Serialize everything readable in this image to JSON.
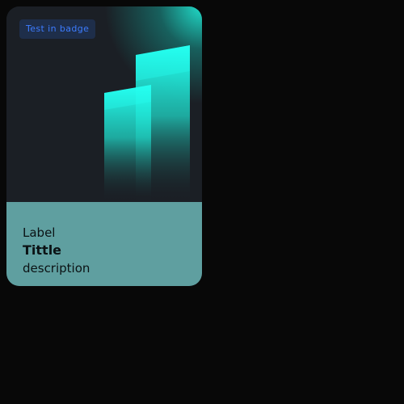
{
  "card": {
    "badge": "Test in badge",
    "label": "Label",
    "title": "Tittle",
    "description": "description"
  },
  "colors": {
    "background": "#080808",
    "hero_background": "#1b1f25",
    "accent_cyan": "#20e6d2",
    "badge_text": "#3d7cff",
    "info_panel": "#5f9fa0",
    "text_dark": "#0b1214"
  }
}
